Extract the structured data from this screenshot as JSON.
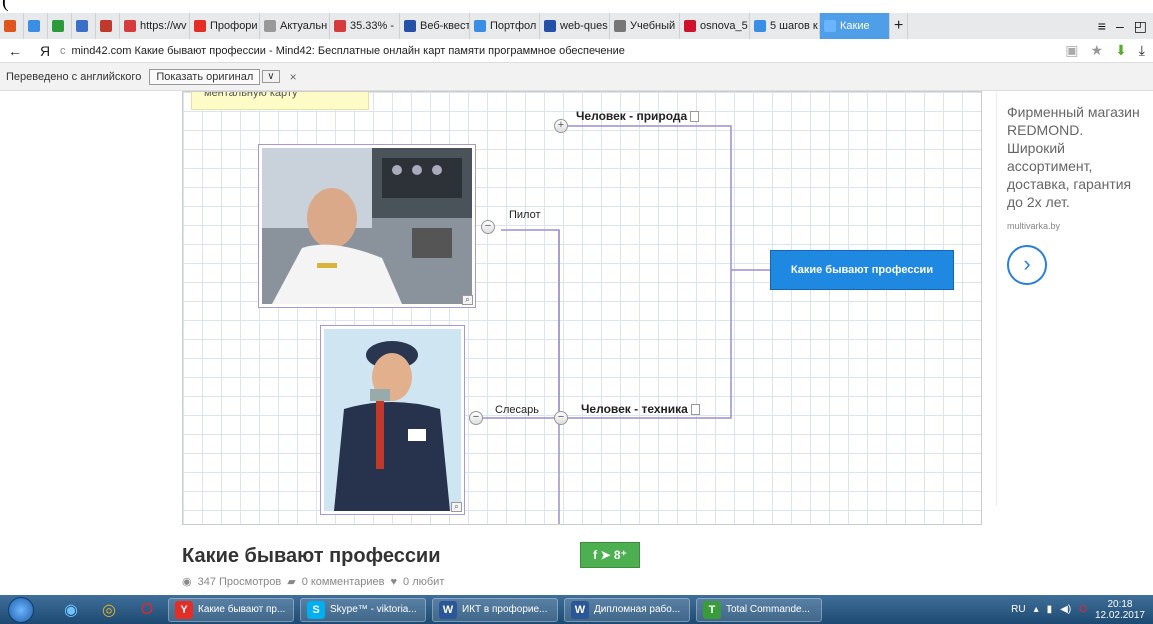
{
  "tabs": [
    {
      "label": "",
      "color": "#e0541e"
    },
    {
      "label": "",
      "color": "#3a8ee6"
    },
    {
      "label": "",
      "color": "#2b9b3a"
    },
    {
      "label": "",
      "color": "#3a70c8"
    },
    {
      "label": "",
      "color": "#c0392b"
    },
    {
      "label": "https://wv",
      "color": "#d63c3c"
    },
    {
      "label": "Профори",
      "color": "#e52d27"
    },
    {
      "label": "Актуальн",
      "color": "#999999"
    },
    {
      "label": "35.33% -",
      "color": "#d63c3c"
    },
    {
      "label": "Веб-квест",
      "color": "#2450a8"
    },
    {
      "label": "Портфол",
      "color": "#3a8ee6"
    },
    {
      "label": "web-ques",
      "color": "#2450a8"
    },
    {
      "label": "Учебный",
      "color": "#777777"
    },
    {
      "label": "osnova_5",
      "color": "#d0112b"
    },
    {
      "label": "5 шагов к",
      "color": "#3a8ee6"
    },
    {
      "label": "Какие",
      "color": "#6ab4ff"
    }
  ],
  "addr": {
    "back": "←",
    "yandex": "Я",
    "reload": "c",
    "url": "mind42.com  Какие бывают профессии - Mind42: Бесплатные онлайн карт памяти программное обеспечение"
  },
  "translate": {
    "label": "Переведено с английского",
    "show_original": "Показать оригинал",
    "dropdown": "∨",
    "close": "×"
  },
  "map": {
    "sticky": "ментальную карту",
    "central": "Какие бывают профессии",
    "node_nature": "Человек - природа",
    "node_tech": "Человек - техника",
    "pilot": "Пилот",
    "locksmith": "Слесарь"
  },
  "ad": {
    "text": "Фирменный магазин REDMOND. Широкий ассортимент, доставка, гарантия до 2х лет.",
    "source": "multivarka.by"
  },
  "page": {
    "title": "Какие бывают профессии",
    "views": "347 Просмотров",
    "comments": "0 комментариев",
    "likes": "0 любит",
    "share": "f ➤ 8⁺"
  },
  "taskbar": {
    "items": [
      {
        "label": "Какие бывают пр...",
        "icon": "Y",
        "color": "#e52d27"
      },
      {
        "label": "Skype™ - viktoria...",
        "icon": "S",
        "color": "#00aff0"
      },
      {
        "label": "ИКТ в профорие...",
        "icon": "W",
        "color": "#2b5797"
      },
      {
        "label": "Дипломная рабо...",
        "icon": "W",
        "color": "#2b5797"
      },
      {
        "label": "Total Commande...",
        "icon": "T",
        "color": "#3a9b3a"
      }
    ],
    "lang": "RU",
    "time": "20:18",
    "date": "12.02.2017"
  }
}
